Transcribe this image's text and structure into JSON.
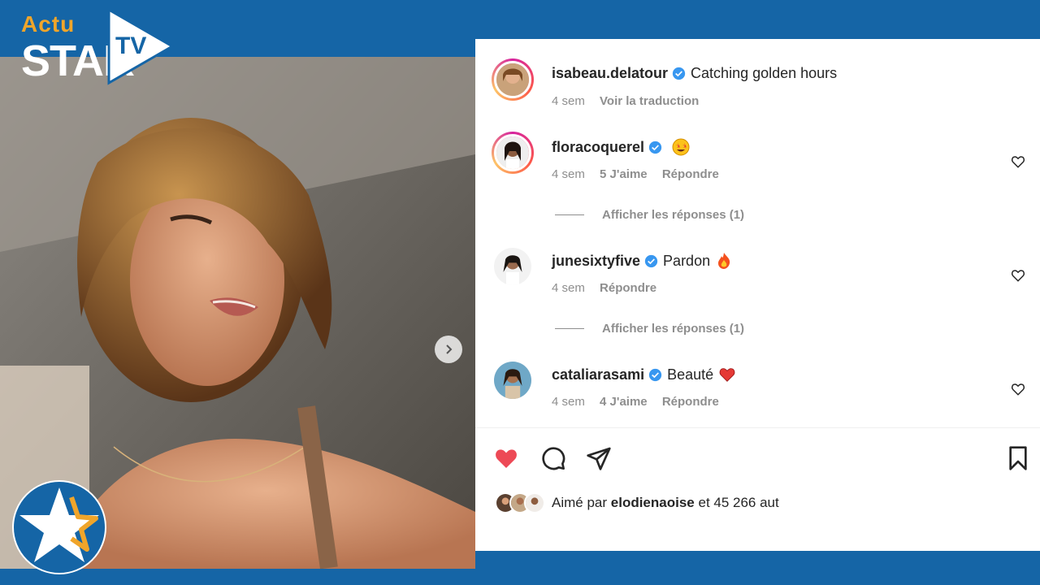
{
  "brand": {
    "actu": "Actu",
    "star": "STAR",
    "tv": "TV"
  },
  "comments": [
    {
      "username": "isabeau.delatour",
      "text": "Catching golden hours",
      "time": "4 sem",
      "likes": "",
      "action": "Voir la traduction",
      "ring": true,
      "emoji": ""
    },
    {
      "username": "floracoquerel",
      "text": "",
      "time": "4 sem",
      "likes": "5 J'aime",
      "action": "Répondre",
      "ring": true,
      "emoji": "star-struck-emoji",
      "replies": "Afficher les réponses (1)"
    },
    {
      "username": "junesixtyfive",
      "text": "Pardon",
      "time": "4 sem",
      "likes": "",
      "action": "Répondre",
      "ring": false,
      "emoji": "fire-emoji",
      "replies": "Afficher les réponses (1)"
    },
    {
      "username": "cataliarasami",
      "text": "Beauté",
      "time": "4 sem",
      "likes": "4 J'aime",
      "action": "Répondre",
      "ring": false,
      "emoji": "red-heart-emoji"
    }
  ],
  "liked_by": {
    "prefix": "Aimé par",
    "user": "elodienaoise",
    "suffix": "et 45 266 aut"
  },
  "icons": [
    "chevron-right-icon",
    "heart-filled-icon",
    "comment-icon",
    "share-icon",
    "bookmark-icon",
    "verified-icon",
    "heart-outline-icon"
  ],
  "colors": {
    "frame": "#1565a6",
    "like": "#ed4956",
    "verified": "#3897f0",
    "accent": "#f0a52a"
  }
}
